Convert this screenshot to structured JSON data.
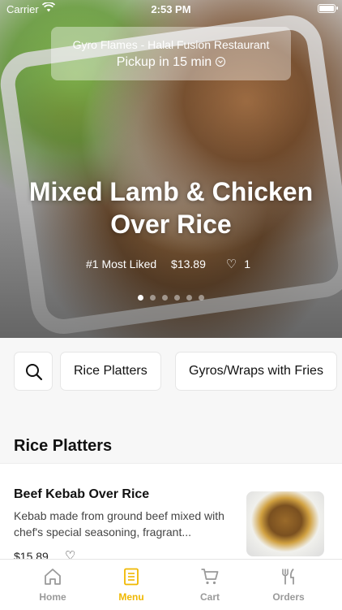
{
  "status_bar": {
    "carrier": "Carrier",
    "time": "2:53 PM"
  },
  "header": {
    "restaurant_name": "Gyro Flames - Halal Fusion Restaurant",
    "pickup_text": "Pickup in 15 min"
  },
  "hero": {
    "dish_title": "Mixed Lamb & Chicken Over Rice",
    "badge": "#1 Most Liked",
    "price": "$13.89",
    "likes": "1",
    "carousel_dots": 6,
    "active_dot": 0
  },
  "categories": {
    "items": [
      "Rice Platters",
      "Gyros/Wraps with Fries"
    ]
  },
  "section": {
    "title": "Rice Platters"
  },
  "menu_item": {
    "name": "Beef Kebab Over Rice",
    "description": "Kebab made from ground beef mixed with chef's special seasoning, fragrant...",
    "price": "$15.89"
  },
  "tabbar": {
    "items": [
      {
        "label": "Home",
        "icon": "home-icon"
      },
      {
        "label": "Menu",
        "icon": "menu-icon"
      },
      {
        "label": "Cart",
        "icon": "cart-icon"
      },
      {
        "label": "Orders",
        "icon": "orders-icon"
      }
    ],
    "active_index": 1,
    "active_color": "#f0b800",
    "inactive_color": "#9a9a9a"
  }
}
